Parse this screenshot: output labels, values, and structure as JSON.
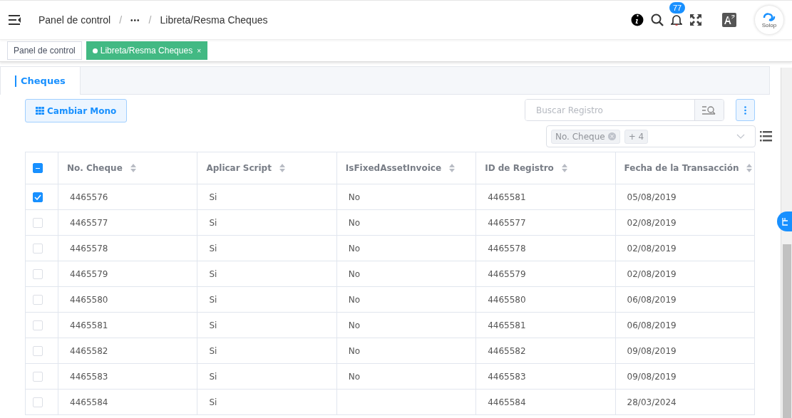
{
  "breadcrumb": [
    "Panel de control",
    "•••",
    "Libreta/Resma Cheques"
  ],
  "breadcrumb_separators": [
    "/",
    "/"
  ],
  "notifications": {
    "count": "77"
  },
  "avatar": {
    "label": "Solop"
  },
  "open_tabs": [
    {
      "label": "Panel de control",
      "selected": false
    },
    {
      "label": "Libreta/Resma Cheques",
      "selected": true,
      "close": "×"
    }
  ],
  "section_tabs": [
    {
      "label": "Cheques",
      "selected": true
    }
  ],
  "toolbar": {
    "toggle_button": "Cambiar Mono",
    "search": {
      "placeholder": "Buscar Registro"
    },
    "column_filter": {
      "tags": [
        "No. Cheque"
      ],
      "more": "+ 4"
    }
  },
  "table": {
    "select_all": {
      "indeterminate": true
    },
    "columns": [
      "No. Cheque",
      "Aplicar Script",
      "IsFixedAssetInvoice",
      "ID de Registro",
      "Fecha de la Transacción"
    ],
    "rows": [
      {
        "selected": true,
        "cells": [
          "4465576",
          "Si",
          "No",
          "4465581",
          "05/08/2019"
        ]
      },
      {
        "selected": false,
        "cells": [
          "4465577",
          "Si",
          "No",
          "4465577",
          "02/08/2019"
        ]
      },
      {
        "selected": false,
        "cells": [
          "4465578",
          "Si",
          "No",
          "4465578",
          "02/08/2019"
        ]
      },
      {
        "selected": false,
        "cells": [
          "4465579",
          "Si",
          "No",
          "4465579",
          "02/08/2019"
        ]
      },
      {
        "selected": false,
        "cells": [
          "4465580",
          "Si",
          "No",
          "4465580",
          "06/08/2019"
        ]
      },
      {
        "selected": false,
        "cells": [
          "4465581",
          "Si",
          "No",
          "4465581",
          "06/08/2019"
        ]
      },
      {
        "selected": false,
        "cells": [
          "4465582",
          "Si",
          "No",
          "4465582",
          "09/08/2019"
        ]
      },
      {
        "selected": false,
        "cells": [
          "4465583",
          "Si",
          "No",
          "4465583",
          "09/08/2019"
        ]
      },
      {
        "selected": false,
        "cells": [
          "4465584",
          "Si",
          null,
          "4465584",
          "28/03/2024"
        ]
      }
    ]
  }
}
